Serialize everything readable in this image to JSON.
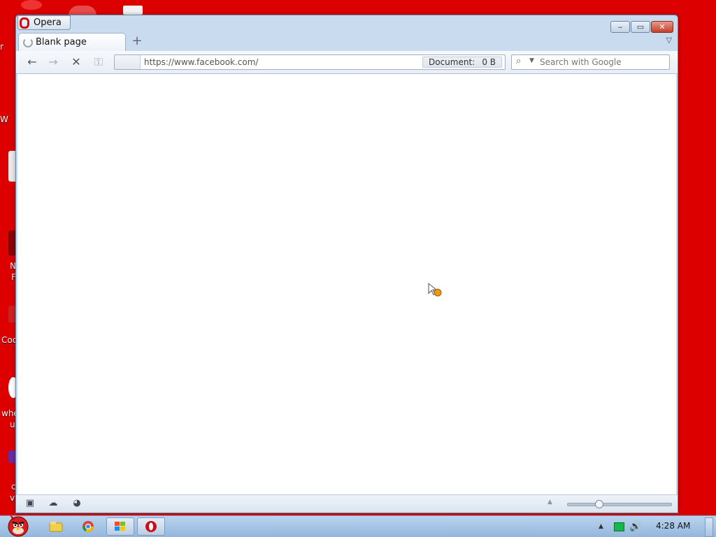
{
  "window": {
    "app_menu_label": "Opera",
    "minimize_label": "‒",
    "maximize_label": "▭",
    "close_label": "✕"
  },
  "tabs": [
    {
      "title": "Blank page",
      "loading": true
    }
  ],
  "new_tab_label": "+",
  "tab_menu_label": "▽",
  "toolbar": {
    "back_icon": "←",
    "forward_icon": "→",
    "stop_icon": "✕",
    "key_icon": "⚿"
  },
  "address": {
    "url": "https://www.facebook.com/",
    "status_label": "Document:",
    "status_value": "0 B"
  },
  "search": {
    "placeholder": "Search with Google",
    "icon": "⌕",
    "caret": "▼"
  },
  "statusbar": {
    "panel_icon": "▣",
    "cloud_icon": "☁",
    "speed_icon": "◕",
    "zoom_up_icon": "▲",
    "zoom_fraction": 0.28
  },
  "taskbar": {
    "tray_arrow": "▲",
    "volume_icon": "🔊",
    "clock": "4:28 AM"
  },
  "desktop_labels": [
    "r",
    "W",
    "N",
    "F",
    "Coo",
    "whe",
    "u",
    "c",
    "v"
  ]
}
